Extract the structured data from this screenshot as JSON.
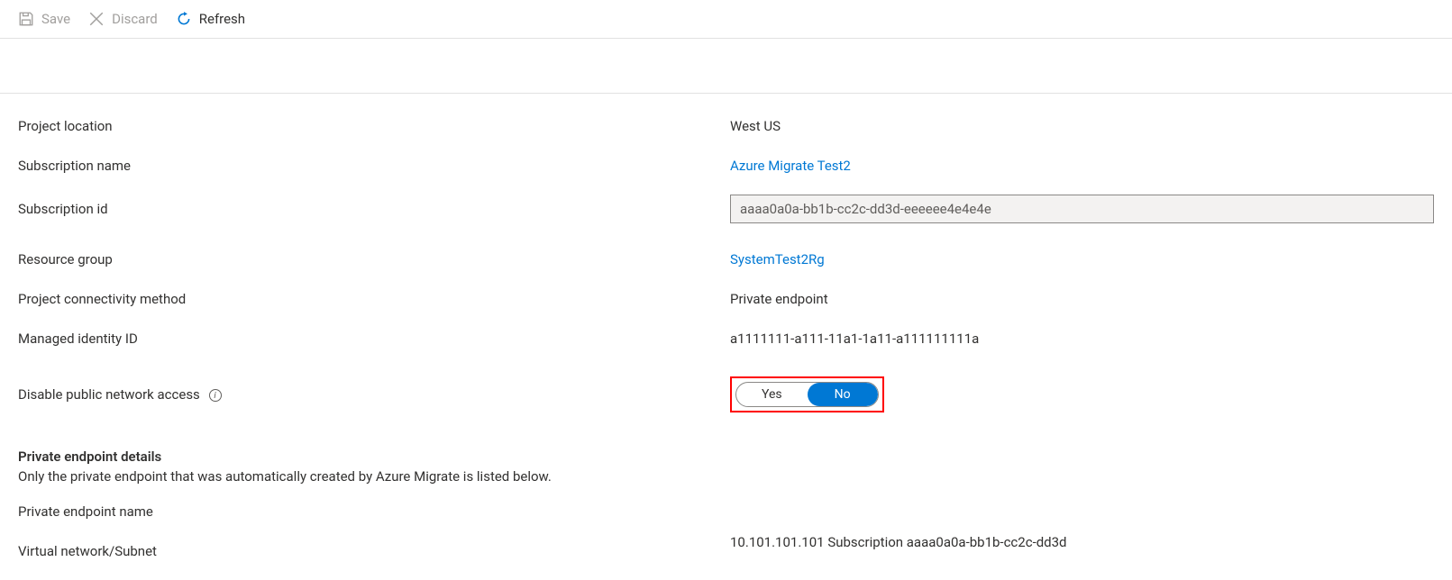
{
  "toolbar": {
    "save_label": "Save",
    "discard_label": "Discard",
    "refresh_label": "Refresh"
  },
  "fields": {
    "project_location": {
      "label": "Project location",
      "value": "West US"
    },
    "subscription_name": {
      "label": "Subscription name",
      "value": "Azure Migrate Test2"
    },
    "subscription_id": {
      "label": "Subscription id",
      "value": "aaaa0a0a-bb1b-cc2c-dd3d-eeeeee4e4e4e"
    },
    "resource_group": {
      "label": "Resource group",
      "value": "SystemTest2Rg"
    },
    "connectivity_method": {
      "label": "Project connectivity method",
      "value": "Private endpoint"
    },
    "managed_identity": {
      "label": "Managed identity ID",
      "value": "a1111111-a111-11a1-1a11-a111111111a"
    },
    "disable_public": {
      "label": "Disable public network access",
      "yes": "Yes",
      "no": "No"
    }
  },
  "section": {
    "title": "Private endpoint details",
    "desc": "Only the private endpoint that was automatically created by Azure Migrate is listed below.",
    "pe_name_label": "Private endpoint name",
    "vnet_label": "Virtual network/Subnet",
    "vnet_value": "10.101.101.101 Subscription aaaa0a0a-bb1b-cc2c-dd3d"
  }
}
